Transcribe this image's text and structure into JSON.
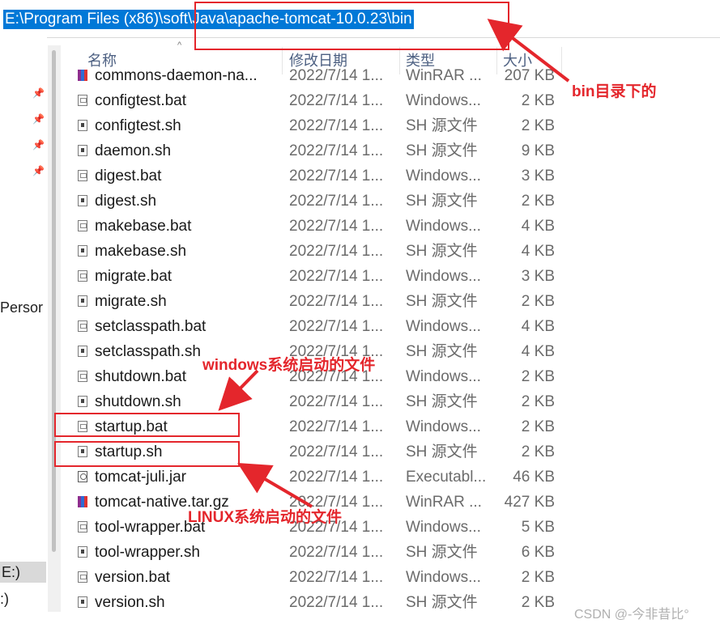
{
  "address_bar": {
    "path": "E:\\Program Files (x86)\\soft\\Java\\apache-tomcat-10.0.23\\bin"
  },
  "sidebar": {
    "nav_label": "Persor",
    "drive_e": "E:)",
    "drive_c": ":)"
  },
  "columns": {
    "name": "名称",
    "date": "修改日期",
    "type": "类型",
    "size": "大小"
  },
  "files": [
    {
      "name": "commons-daemon-na...",
      "date": "2022/7/14 1...",
      "type": "WinRAR ...",
      "size": "207 KB",
      "icon": "rar-icon"
    },
    {
      "name": "configtest.bat",
      "date": "2022/7/14 1...",
      "type": "Windows...",
      "size": "2 KB",
      "icon": "bat-file-icon"
    },
    {
      "name": "configtest.sh",
      "date": "2022/7/14 1...",
      "type": "SH 源文件",
      "size": "2 KB",
      "icon": "sh-file-icon"
    },
    {
      "name": "daemon.sh",
      "date": "2022/7/14 1...",
      "type": "SH 源文件",
      "size": "9 KB",
      "icon": "sh-file-icon"
    },
    {
      "name": "digest.bat",
      "date": "2022/7/14 1...",
      "type": "Windows...",
      "size": "3 KB",
      "icon": "bat-file-icon"
    },
    {
      "name": "digest.sh",
      "date": "2022/7/14 1...",
      "type": "SH 源文件",
      "size": "2 KB",
      "icon": "sh-file-icon"
    },
    {
      "name": "makebase.bat",
      "date": "2022/7/14 1...",
      "type": "Windows...",
      "size": "4 KB",
      "icon": "bat-file-icon"
    },
    {
      "name": "makebase.sh",
      "date": "2022/7/14 1...",
      "type": "SH 源文件",
      "size": "4 KB",
      "icon": "sh-file-icon"
    },
    {
      "name": "migrate.bat",
      "date": "2022/7/14 1...",
      "type": "Windows...",
      "size": "3 KB",
      "icon": "bat-file-icon"
    },
    {
      "name": "migrate.sh",
      "date": "2022/7/14 1...",
      "type": "SH 源文件",
      "size": "2 KB",
      "icon": "sh-file-icon"
    },
    {
      "name": "setclasspath.bat",
      "date": "2022/7/14 1...",
      "type": "Windows...",
      "size": "4 KB",
      "icon": "bat-file-icon"
    },
    {
      "name": "setclasspath.sh",
      "date": "2022/7/14 1...",
      "type": "SH 源文件",
      "size": "4 KB",
      "icon": "sh-file-icon"
    },
    {
      "name": "shutdown.bat",
      "date": "2022/7/14 1...",
      "type": "Windows...",
      "size": "2 KB",
      "icon": "bat-file-icon"
    },
    {
      "name": "shutdown.sh",
      "date": "2022/7/14 1...",
      "type": "SH 源文件",
      "size": "2 KB",
      "icon": "sh-file-icon"
    },
    {
      "name": "startup.bat",
      "date": "2022/7/14 1...",
      "type": "Windows...",
      "size": "2 KB",
      "icon": "bat-file-icon"
    },
    {
      "name": "startup.sh",
      "date": "2022/7/14 1...",
      "type": "SH 源文件",
      "size": "2 KB",
      "icon": "sh-file-icon"
    },
    {
      "name": "tomcat-juli.jar",
      "date": "2022/7/14 1...",
      "type": "Executabl...",
      "size": "46 KB",
      "icon": "jar-file-icon"
    },
    {
      "name": "tomcat-native.tar.gz",
      "date": "2022/7/14 1...",
      "type": "WinRAR ...",
      "size": "427 KB",
      "icon": "rar-icon"
    },
    {
      "name": "tool-wrapper.bat",
      "date": "2022/7/14 1...",
      "type": "Windows...",
      "size": "5 KB",
      "icon": "bat-file-icon"
    },
    {
      "name": "tool-wrapper.sh",
      "date": "2022/7/14 1...",
      "type": "SH 源文件",
      "size": "6 KB",
      "icon": "sh-file-icon"
    },
    {
      "name": "version.bat",
      "date": "2022/7/14 1...",
      "type": "Windows...",
      "size": "2 KB",
      "icon": "bat-file-icon"
    },
    {
      "name": "version.sh",
      "date": "2022/7/14 1...",
      "type": "SH 源文件",
      "size": "2 KB",
      "icon": "sh-file-icon"
    }
  ],
  "annotations": {
    "bin_label": "bin目录下的",
    "windows_label": "windows系统启动的文件",
    "linux_label": "LINUX系统启动的文件",
    "color": "#e4262c"
  },
  "watermark": "CSDN @-今非昔比°",
  "colors": {
    "selection": "#0078d7",
    "header_text": "#4d6082"
  }
}
